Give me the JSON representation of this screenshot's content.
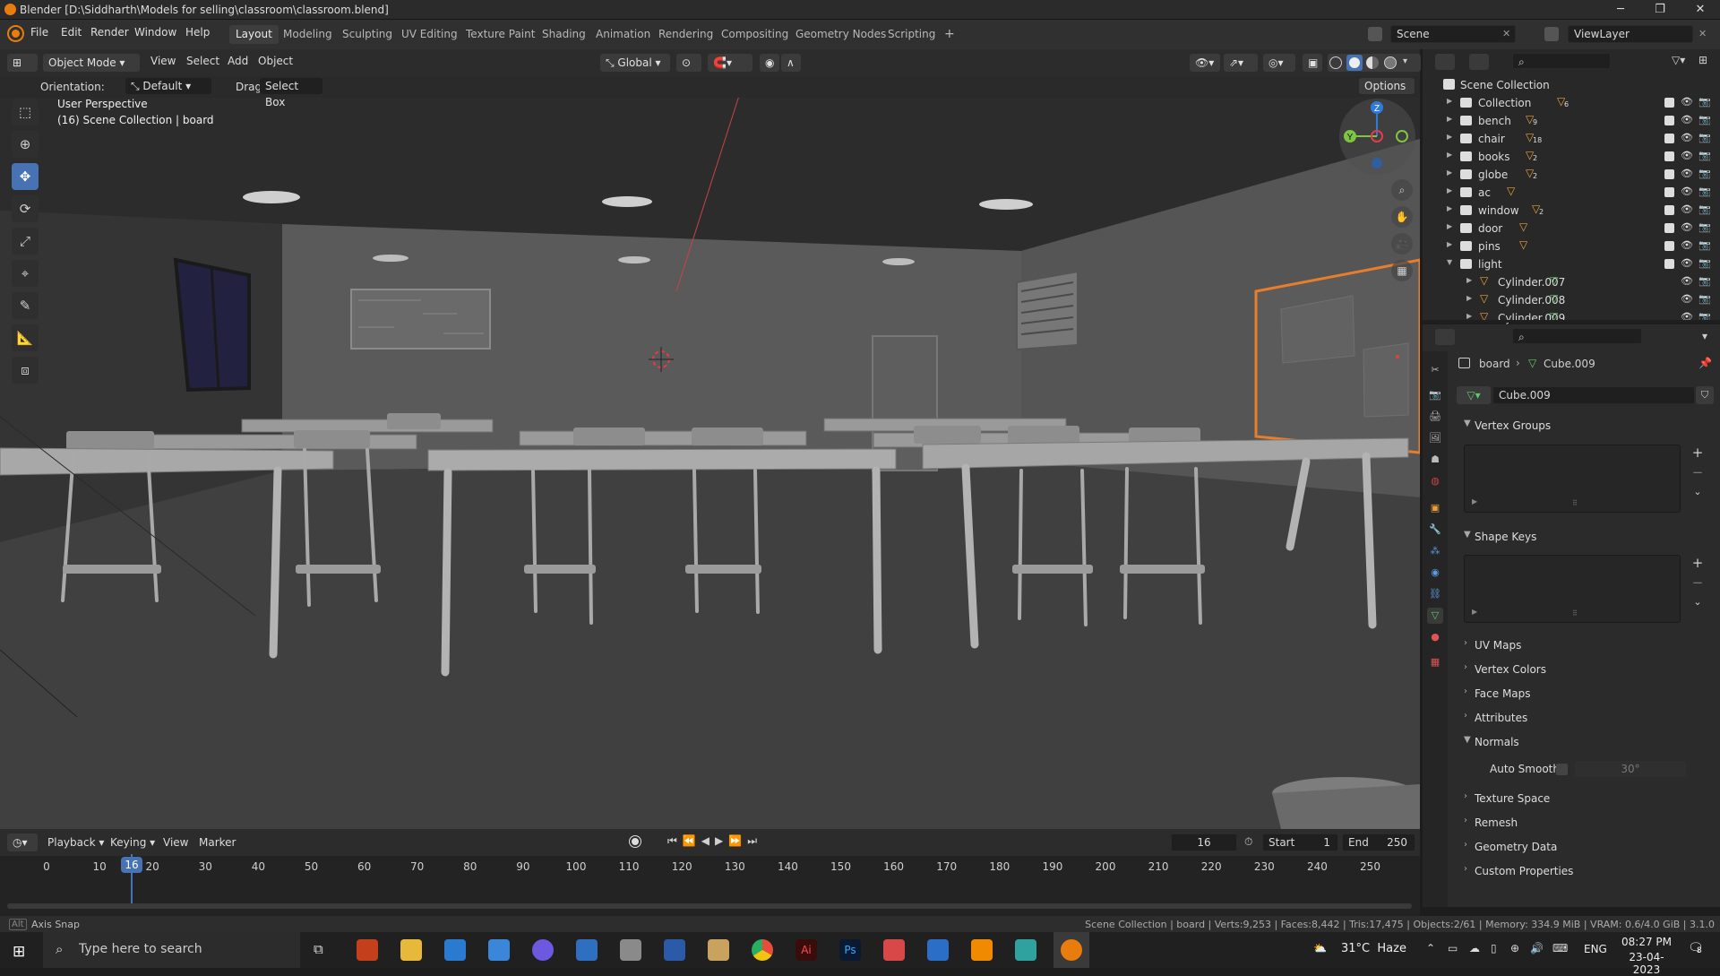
{
  "window": {
    "title": "Blender [D:\\Siddharth\\Models for selling\\classroom\\classroom.blend]",
    "minimize": "─",
    "maximize": "❐",
    "close": "✕"
  },
  "menubar": {
    "items": [
      "File",
      "Edit",
      "Render",
      "Window",
      "Help"
    ],
    "workspaces": [
      "Layout",
      "Modeling",
      "Sculpting",
      "UV Editing",
      "Texture Paint",
      "Shading",
      "Animation",
      "Rendering",
      "Compositing",
      "Geometry Nodes",
      "Scripting"
    ],
    "add_workspace": "+",
    "scene_label": "Scene",
    "viewlayer_label": "ViewLayer"
  },
  "viewport_header": {
    "mode": "Object Mode",
    "menus": [
      "View",
      "Select",
      "Add",
      "Object"
    ],
    "transform_orientation": "Global",
    "orientation_label": "Orientation:",
    "orientation_value": "Default",
    "drag_label": "Drag:",
    "drag_value": "Select Box",
    "options": "Options"
  },
  "viewport": {
    "view_name": "User Perspective",
    "collection_info": "(16) Scene Collection | board",
    "gizmo_axes": [
      "X",
      "Y",
      "Z"
    ]
  },
  "outliner": {
    "search_placeholder": "",
    "root": "Scene Collection",
    "items": [
      {
        "name": "Collection",
        "badge": "6",
        "indent": 0,
        "expanded": false,
        "extra_icon": true
      },
      {
        "name": "bench",
        "badge": "9",
        "indent": 0,
        "expanded": false
      },
      {
        "name": "chair",
        "badge": "18",
        "indent": 0,
        "expanded": false
      },
      {
        "name": "books",
        "badge": "2",
        "indent": 0,
        "expanded": false
      },
      {
        "name": "globe",
        "badge": "2",
        "indent": 0,
        "expanded": false
      },
      {
        "name": "ac",
        "badge": "",
        "indent": 0,
        "expanded": false
      },
      {
        "name": "window",
        "badge": "2",
        "indent": 0,
        "expanded": false
      },
      {
        "name": "door",
        "badge": "",
        "indent": 0,
        "expanded": false
      },
      {
        "name": "pins",
        "badge": "",
        "indent": 0,
        "expanded": false
      },
      {
        "name": "light",
        "badge": "",
        "indent": 0,
        "expanded": true
      },
      {
        "name": "Cylinder.007",
        "badge": "",
        "indent": 1,
        "expanded": false
      },
      {
        "name": "Cylinder.008",
        "badge": "",
        "indent": 1,
        "expanded": false
      },
      {
        "name": "Cylinder.009",
        "badge": "",
        "indent": 1,
        "expanded": false
      }
    ]
  },
  "properties": {
    "breadcrumb_object": "board",
    "breadcrumb_data": "Cube.009",
    "datablock_name": "Cube.009",
    "sections": {
      "vertex_groups": "Vertex Groups",
      "shape_keys": "Shape Keys",
      "uv_maps": "UV Maps",
      "vertex_colors": "Vertex Colors",
      "face_maps": "Face Maps",
      "attributes": "Attributes",
      "normals": "Normals",
      "auto_smooth": "Auto Smooth",
      "auto_smooth_angle": "30°",
      "texture_space": "Texture Space",
      "remesh": "Remesh",
      "geometry_data": "Geometry Data",
      "custom_properties": "Custom Properties"
    }
  },
  "timeline": {
    "menus": [
      "Playback",
      "Keying",
      "View",
      "Marker"
    ],
    "current_frame": "16",
    "start_label": "Start",
    "start": "1",
    "end_label": "End",
    "end": "250",
    "ticks": [
      "0",
      "10",
      "20",
      "30",
      "40",
      "50",
      "60",
      "70",
      "80",
      "90",
      "100",
      "110",
      "120",
      "130",
      "140",
      "150",
      "160",
      "170",
      "180",
      "190",
      "200",
      "210",
      "220",
      "230",
      "240",
      "250"
    ],
    "current_frame_marker": "16"
  },
  "statusbar": {
    "left": "Axis Snap",
    "right": "Scene Collection | board | Verts:9,253 | Faces:8,442 | Tris:17,475 | Objects:2/61 | Memory: 334.9 MiB | VRAM: 0.6/4.0 GiB | 3.1.0"
  },
  "taskbar": {
    "search_placeholder": "Type here to search",
    "weather": "31°C  Haze",
    "lang": "ENG",
    "time": "08:27 PM",
    "date": "23-04-2023",
    "notifications": "8"
  },
  "colors": {
    "accent": "#4772b3",
    "selection_outline": "#e87d2c",
    "x_axis": "#e23c4a",
    "y_axis": "#7ec63f",
    "z_axis": "#2f7bd9",
    "object_icon": "#e8a13a",
    "mesh_icon": "#5fc86a"
  }
}
